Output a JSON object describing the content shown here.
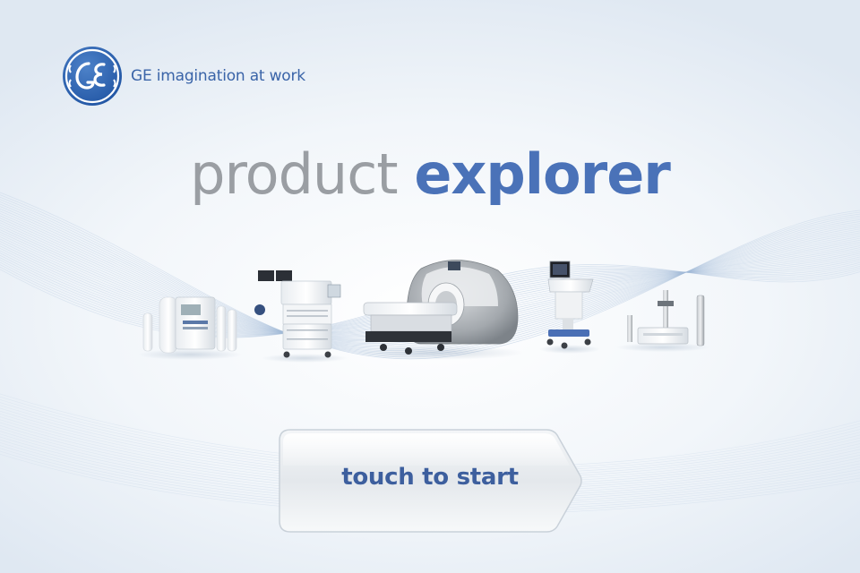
{
  "brand": {
    "logo_icon": "ge-monogram-icon",
    "tagline": "GE imagination at work",
    "accent_color": "#3a64a8"
  },
  "title": {
    "part1": "product",
    "part2": "explorer",
    "part1_color": "#9a9ea3",
    "part2_color": "#4a72b8"
  },
  "products": [
    {
      "name": "monitoring-device-icon"
    },
    {
      "name": "anesthesia-machine-icon"
    },
    {
      "name": "mri-scanner-icon"
    },
    {
      "name": "ultrasound-cart-icon"
    },
    {
      "name": "xray-system-icon"
    }
  ],
  "start_button": {
    "label": "touch to start"
  }
}
